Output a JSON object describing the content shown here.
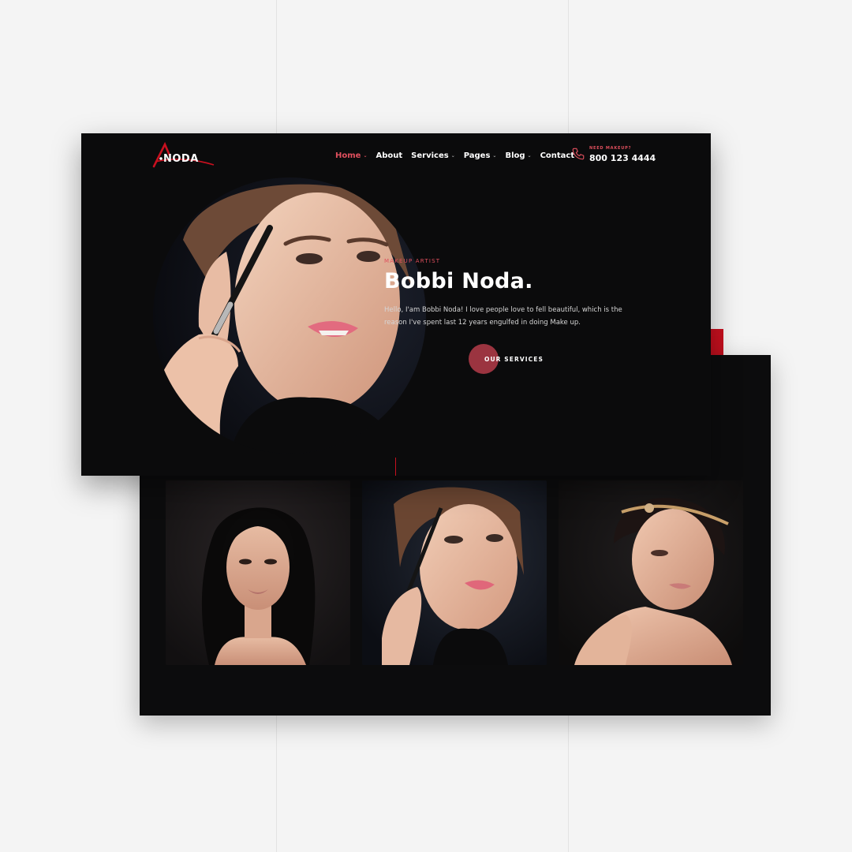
{
  "brand": {
    "logo_text": "NODA",
    "accent": "#e0505e",
    "red": "#c8101f",
    "bg": "#0b0b0c"
  },
  "nav": {
    "items": [
      {
        "label": "Home",
        "active": true,
        "dropdown": true
      },
      {
        "label": "About",
        "active": false,
        "dropdown": false
      },
      {
        "label": "Services",
        "active": false,
        "dropdown": true
      },
      {
        "label": "Pages",
        "active": false,
        "dropdown": true
      },
      {
        "label": "Blog",
        "active": false,
        "dropdown": true
      },
      {
        "label": "Contact",
        "active": false,
        "dropdown": false
      }
    ],
    "chevron": "⌄"
  },
  "contact": {
    "label": "NEED MAKEUP?",
    "phone": "800 123 4444",
    "icon": "phone-icon"
  },
  "hero": {
    "eyebrow": "MAKEUP ARTIST",
    "title": "Bobbi Noda.",
    "text": "Hello, I'am Bobbi Noda! I love people love to fell beautiful, which is the reason I've spent last 12 years engulfed in doing Make up.",
    "cta": "OUR SERVICES"
  },
  "gallery": {
    "items": [
      {
        "alt_name": "portrait-dark-hair"
      },
      {
        "alt_name": "portrait-mascara"
      },
      {
        "alt_name": "portrait-headpiece"
      }
    ]
  }
}
